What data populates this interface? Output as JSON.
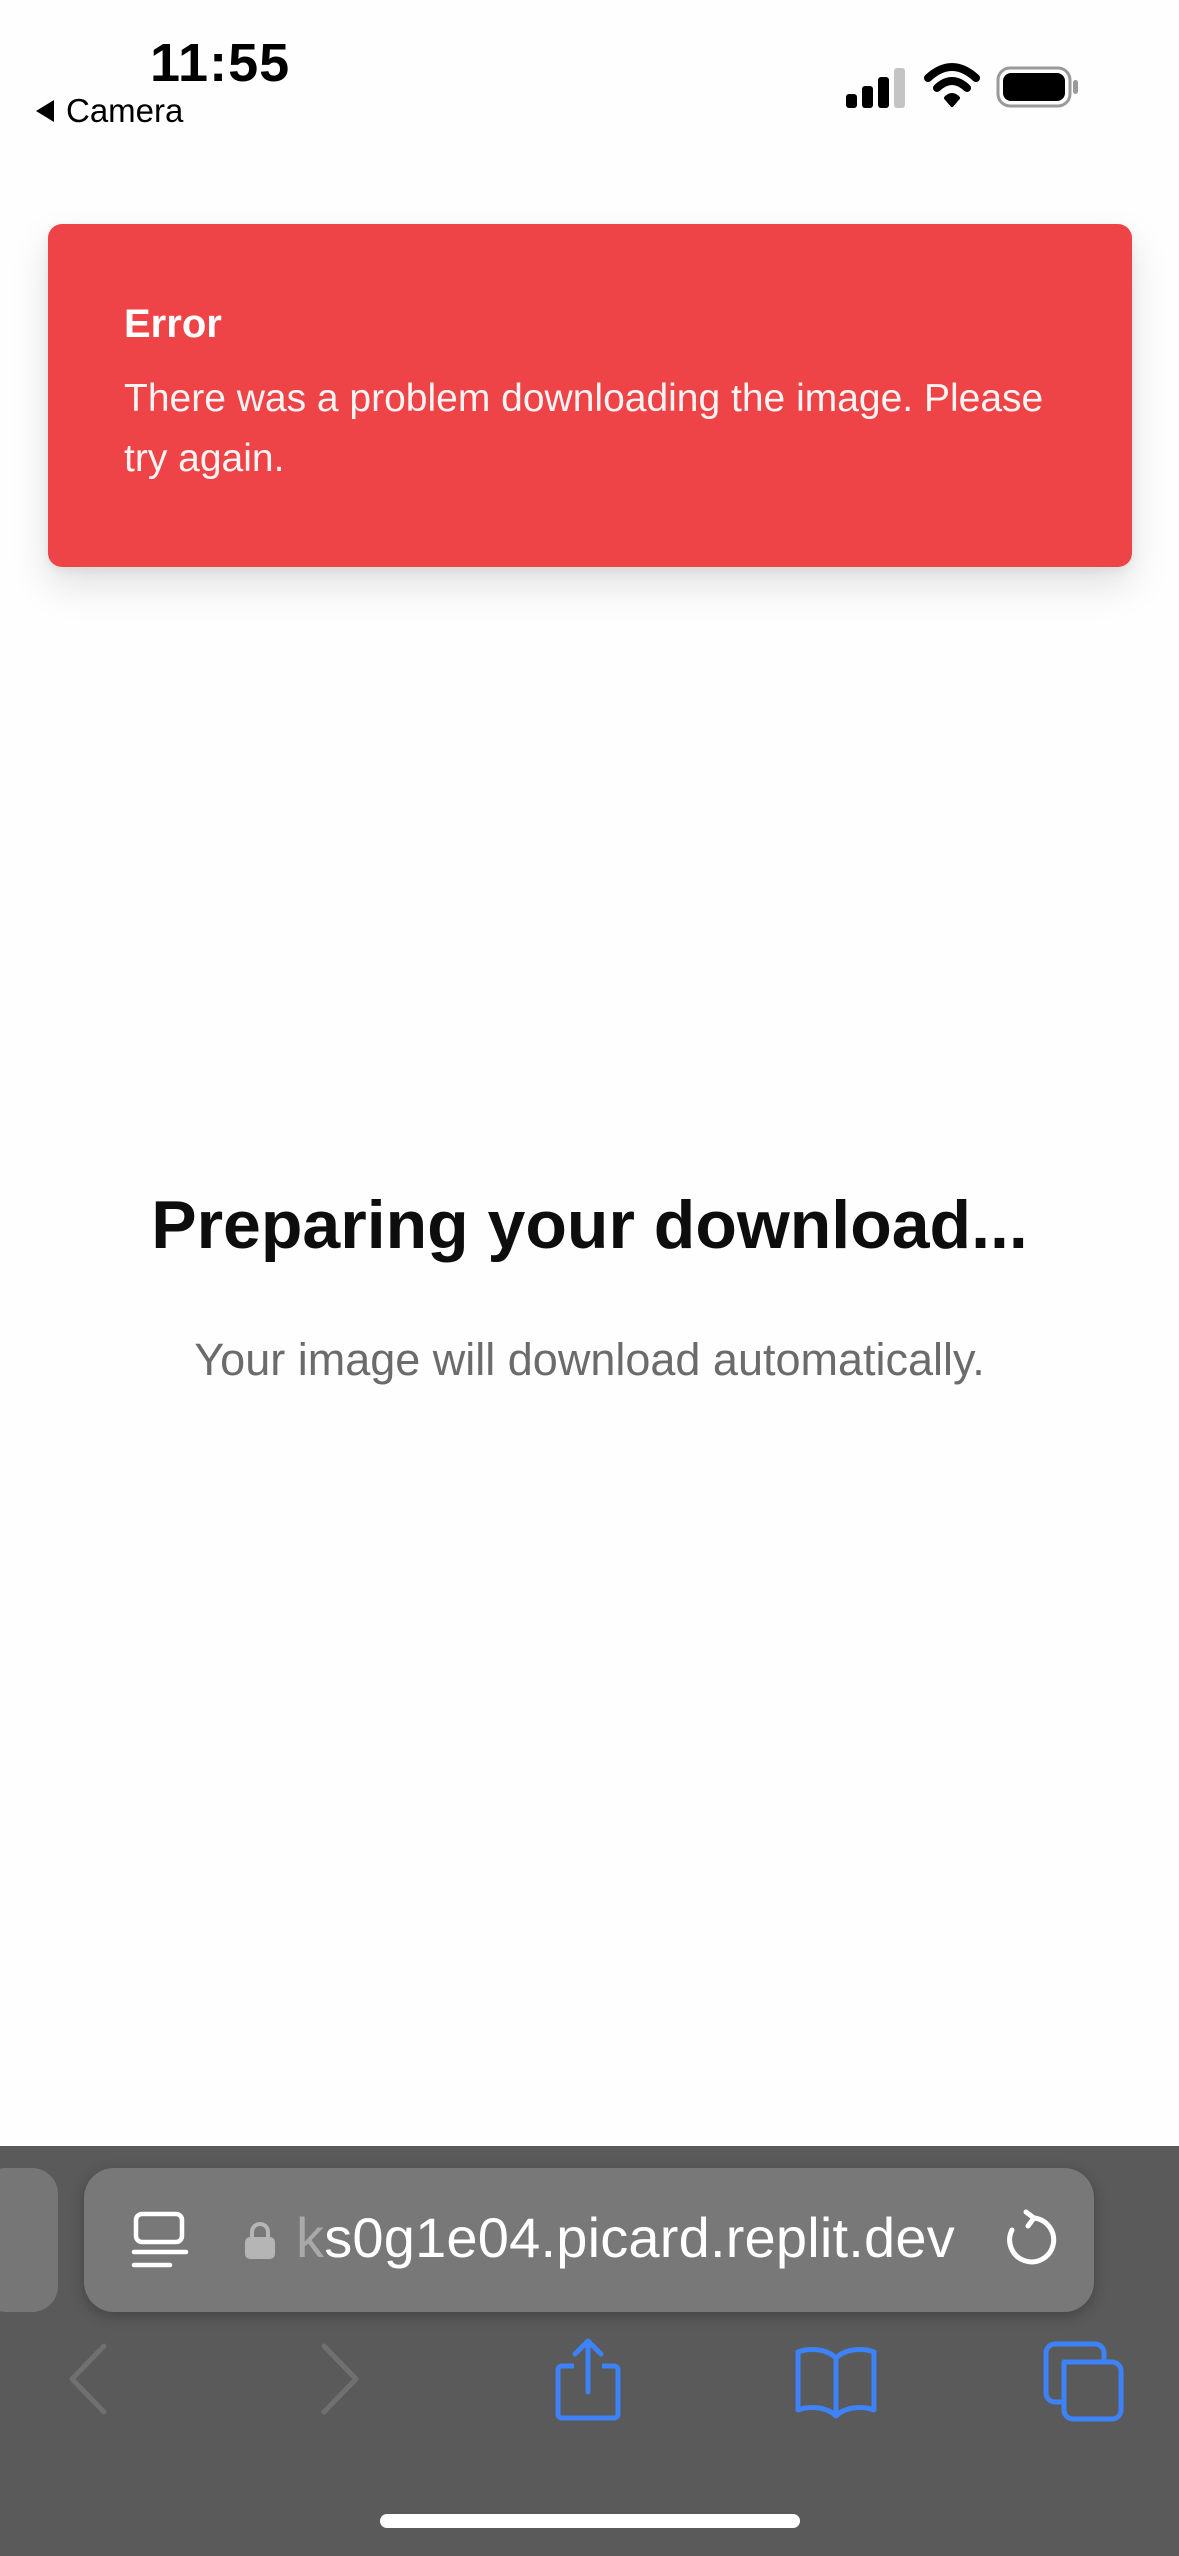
{
  "status_bar": {
    "time": "11:55",
    "back_app": "Camera",
    "signal_icon": "cellular-signal-icon",
    "wifi_icon": "wifi-icon",
    "battery_icon": "battery-icon"
  },
  "toast": {
    "title": "Error",
    "message": "There was a problem downloading the image. Please try again.",
    "background_color": "#ef4447"
  },
  "main": {
    "heading": "Preparing your download...",
    "subtext": "Your image will download automatically."
  },
  "browser": {
    "url_faded_prefix": "k",
    "url_text": "s0g1e04.picard.replit.dev",
    "accent_color": "#3e82f7"
  }
}
